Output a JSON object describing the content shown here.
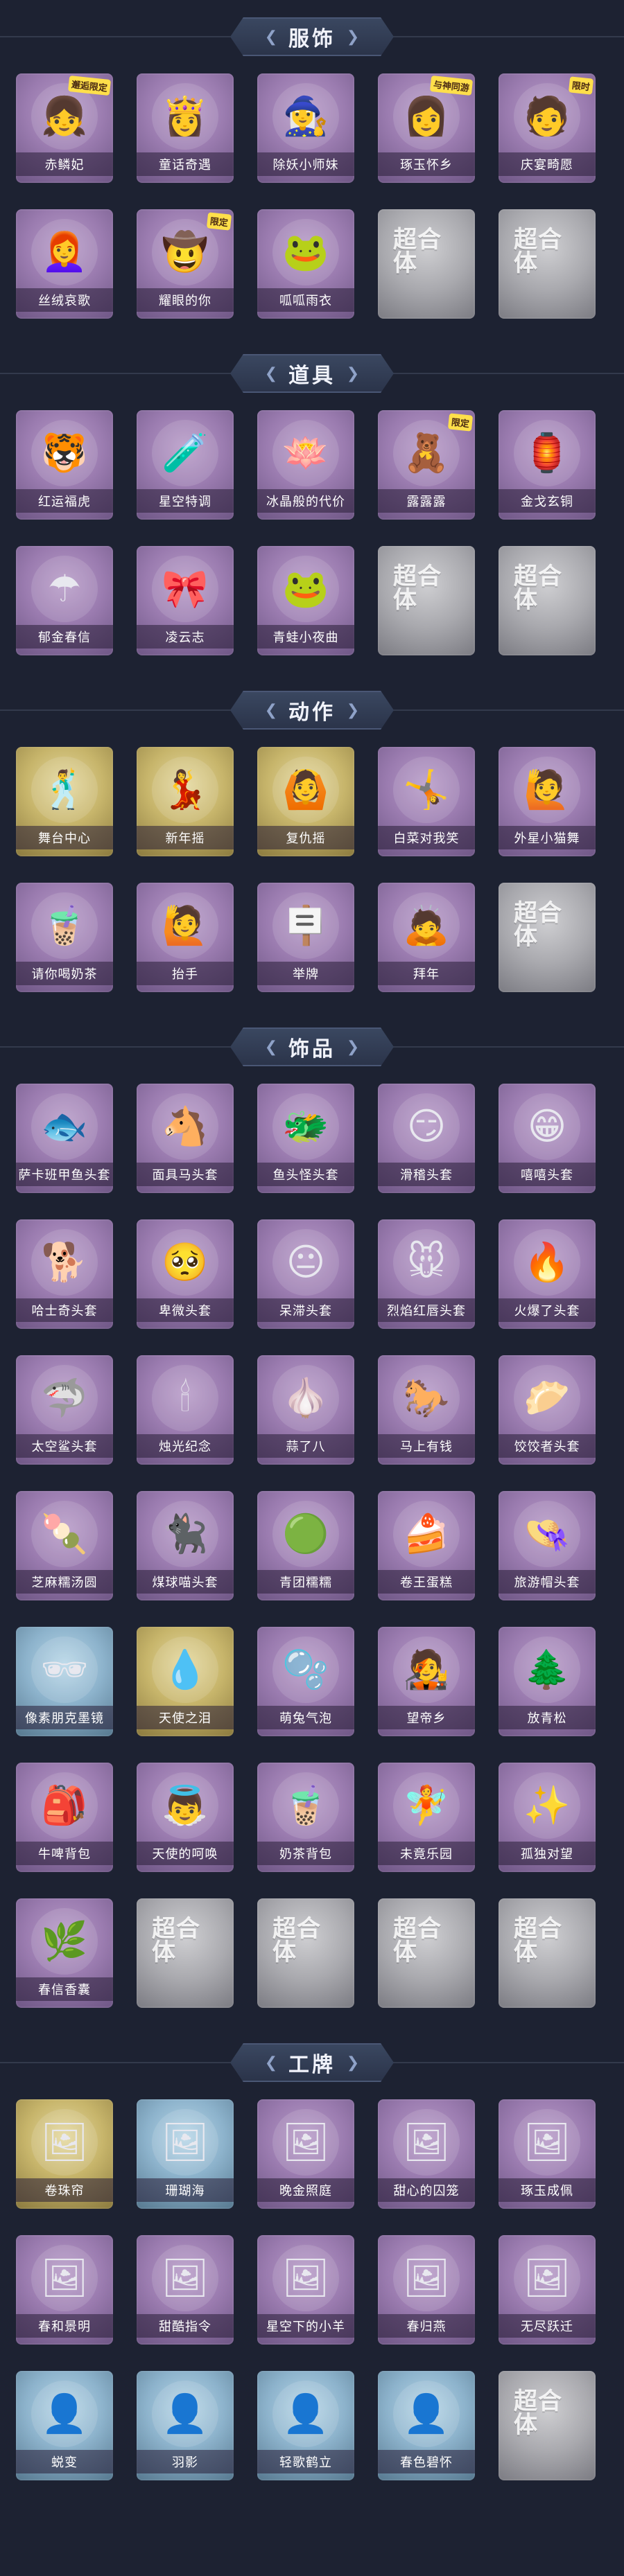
{
  "sections": [
    {
      "title": "服饰",
      "items": [
        {
          "label": "赤鳞妃",
          "style": "purple",
          "icon": "girl-costume-icon",
          "glyph": "👧",
          "badge": "邂逅限定"
        },
        {
          "label": "童话奇遇",
          "style": "purple",
          "icon": "girl-costume-icon",
          "glyph": "👸"
        },
        {
          "label": "除妖小师妹",
          "style": "purple",
          "icon": "girl-costume-icon",
          "glyph": "🧙‍♀️"
        },
        {
          "label": "琢玉怀乡",
          "style": "purple",
          "icon": "girl-costume-icon",
          "glyph": "👩",
          "badge": "与神同游"
        },
        {
          "label": "庆宴畸愿",
          "style": "purple",
          "icon": "girl-costume-icon",
          "glyph": "🧑",
          "badge": "限时"
        },
        {
          "label": "丝绒哀歌",
          "style": "purple",
          "icon": "girl-costume-icon",
          "glyph": "👩‍🦰"
        },
        {
          "label": "耀眼的你",
          "style": "purple",
          "icon": "girl-costume-icon",
          "glyph": "🤠",
          "badge": "限定"
        },
        {
          "label": "呱呱雨衣",
          "style": "purple",
          "icon": "frog-raincoat-icon",
          "glyph": "🐸"
        },
        {
          "label": "",
          "style": "gray",
          "icon": "placeholder-logo-icon",
          "placeholder": "超合体"
        },
        {
          "label": "",
          "style": "gray",
          "icon": "placeholder-logo-icon",
          "placeholder": "超合体"
        }
      ]
    },
    {
      "title": "道具",
      "items": [
        {
          "label": "红运福虎",
          "style": "purple",
          "icon": "tiger-icon",
          "glyph": "🐯"
        },
        {
          "label": "星空特调",
          "style": "purple",
          "icon": "bottle-icon",
          "glyph": "🧪"
        },
        {
          "label": "冰晶般的代价",
          "style": "purple",
          "icon": "lotus-icon",
          "glyph": "🪷"
        },
        {
          "label": "露露露",
          "style": "purple",
          "icon": "doll-icon",
          "glyph": "🧸",
          "badge": "限定"
        },
        {
          "label": "金戈玄铜",
          "style": "purple",
          "icon": "lantern-icon",
          "glyph": "🏮"
        },
        {
          "label": "郁金春信",
          "style": "purple",
          "icon": "umbrella-icon",
          "glyph": "☂"
        },
        {
          "label": "凌云志",
          "style": "purple",
          "icon": "ribbon-icon",
          "glyph": "🎀"
        },
        {
          "label": "青蛙小夜曲",
          "style": "purple",
          "icon": "frog-icon",
          "glyph": "🐸"
        },
        {
          "label": "",
          "style": "gray",
          "icon": "placeholder-logo-icon",
          "placeholder": "超合体"
        },
        {
          "label": "",
          "style": "gray",
          "icon": "placeholder-logo-icon",
          "placeholder": "超合体"
        }
      ]
    },
    {
      "title": "动作",
      "items": [
        {
          "label": "舞台中心",
          "style": "gold",
          "icon": "dance-pose-icon",
          "glyph": "🕺"
        },
        {
          "label": "新年摇",
          "style": "gold",
          "icon": "dance-pose-icon",
          "glyph": "💃"
        },
        {
          "label": "复仇摇",
          "style": "gold",
          "icon": "dance-pose-icon",
          "glyph": "🙆"
        },
        {
          "label": "白菜对我笑",
          "style": "purple",
          "icon": "dance-pose-icon",
          "glyph": "🤸"
        },
        {
          "label": "外星小猫舞",
          "style": "purple",
          "icon": "dance-pose-icon",
          "glyph": "🙋"
        },
        {
          "label": "请你喝奶茶",
          "style": "purple",
          "icon": "milk-tea-pose-icon",
          "glyph": "🧋"
        },
        {
          "label": "抬手",
          "style": "purple",
          "icon": "raise-hand-pose-icon",
          "glyph": "🙋"
        },
        {
          "label": "举牌",
          "style": "purple",
          "icon": "sign-pose-icon",
          "glyph": "🪧"
        },
        {
          "label": "拜年",
          "style": "purple",
          "icon": "bow-pose-icon",
          "glyph": "🙇"
        },
        {
          "label": "",
          "style": "gray",
          "icon": "placeholder-logo-icon",
          "placeholder": "超合体"
        }
      ]
    },
    {
      "title": "饰品",
      "items": [
        {
          "label": "萨卡班甲鱼头套",
          "style": "purple",
          "icon": "fish-head-icon",
          "glyph": "🐟"
        },
        {
          "label": "面具马头套",
          "style": "purple",
          "icon": "horse-head-icon",
          "glyph": "🐴"
        },
        {
          "label": "鱼头怪头套",
          "style": "purple",
          "icon": "fish-monster-icon",
          "glyph": "🐲"
        },
        {
          "label": "滑稽头套",
          "style": "purple",
          "icon": "smile-face-icon",
          "glyph": "😏"
        },
        {
          "label": "嘻嘻头套",
          "style": "purple",
          "icon": "grin-face-icon",
          "glyph": "😁"
        },
        {
          "label": "哈士奇头套",
          "style": "purple",
          "icon": "husky-icon",
          "glyph": "🐕"
        },
        {
          "label": "卑微头套",
          "style": "purple",
          "icon": "sad-face-icon",
          "glyph": "🥺"
        },
        {
          "label": "呆滞头套",
          "style": "purple",
          "icon": "blank-face-icon",
          "glyph": "😐"
        },
        {
          "label": "烈焰红唇头套",
          "style": "purple",
          "icon": "pikachu-icon",
          "glyph": "🐭"
        },
        {
          "label": "火爆了头套",
          "style": "purple",
          "icon": "fire-icon",
          "glyph": "🔥"
        },
        {
          "label": "太空鲨头套",
          "style": "purple",
          "icon": "shark-icon",
          "glyph": "🦈"
        },
        {
          "label": "烛光纪念",
          "style": "purple",
          "icon": "candle-icon",
          "glyph": "🕯"
        },
        {
          "label": "蒜了八",
          "style": "purple",
          "icon": "garlic-icon",
          "glyph": "🧄"
        },
        {
          "label": "马上有钱",
          "style": "purple",
          "icon": "horse-toy-icon",
          "glyph": "🐎"
        },
        {
          "label": "饺饺者头套",
          "style": "purple",
          "icon": "dumpling-icon",
          "glyph": "🥟"
        },
        {
          "label": "芝麻糯汤圆",
          "style": "purple",
          "icon": "rice-ball-icon",
          "glyph": "🍡"
        },
        {
          "label": "煤球喵头套",
          "style": "purple",
          "icon": "black-cat-icon",
          "glyph": "🐈‍⬛"
        },
        {
          "label": "青团糯糯",
          "style": "purple",
          "icon": "green-ball-icon",
          "glyph": "🟢"
        },
        {
          "label": "卷王蛋糕",
          "style": "purple",
          "icon": "cake-roll-icon",
          "glyph": "🍰"
        },
        {
          "label": "旅游帽头套",
          "style": "purple",
          "icon": "hat-icon",
          "glyph": "👒"
        },
        {
          "label": "像素朋克墨镜",
          "style": "blue",
          "icon": "pixel-sunglasses-icon",
          "glyph": "🕶"
        },
        {
          "label": "天使之泪",
          "style": "gold",
          "icon": "angel-tear-icon",
          "glyph": "💧"
        },
        {
          "label": "萌兔气泡",
          "style": "purple",
          "icon": "bubble-icon",
          "glyph": "🫧"
        },
        {
          "label": "望帝乡",
          "style": "purple",
          "icon": "figure-icon",
          "glyph": "🧑‍🎤"
        },
        {
          "label": "放青松",
          "style": "purple",
          "icon": "bonsai-icon",
          "glyph": "🌲"
        },
        {
          "label": "牛啤背包",
          "style": "purple",
          "icon": "backpack-icon",
          "glyph": "🎒"
        },
        {
          "label": "天使的呵唤",
          "style": "purple",
          "icon": "angel-icon",
          "glyph": "👼"
        },
        {
          "label": "奶茶背包",
          "style": "purple",
          "icon": "tea-bag-icon",
          "glyph": "🧋"
        },
        {
          "label": "未竟乐园",
          "style": "purple",
          "icon": "fairy-icon",
          "glyph": "🧚"
        },
        {
          "label": "孤独对望",
          "style": "purple",
          "icon": "star-charm-icon",
          "glyph": "✨"
        },
        {
          "label": "春信香囊",
          "style": "purple",
          "icon": "sachet-icon",
          "glyph": "🌿"
        },
        {
          "label": "",
          "style": "gray",
          "icon": "placeholder-logo-icon",
          "placeholder": "超合体"
        },
        {
          "label": "",
          "style": "gray",
          "icon": "placeholder-logo-icon",
          "placeholder": "超合体"
        },
        {
          "label": "",
          "style": "gray",
          "icon": "placeholder-logo-icon",
          "placeholder": "超合体"
        },
        {
          "label": "",
          "style": "gray",
          "icon": "placeholder-logo-icon",
          "placeholder": "超合体"
        }
      ]
    },
    {
      "title": "工牌",
      "items": [
        {
          "label": "卷珠帘",
          "style": "gold",
          "icon": "card-frame-icon",
          "glyph": "🖼"
        },
        {
          "label": "珊瑚海",
          "style": "blue",
          "icon": "card-frame-icon",
          "glyph": "🖼"
        },
        {
          "label": "晚金照庭",
          "style": "purple",
          "icon": "card-frame-icon",
          "glyph": "🖼"
        },
        {
          "label": "甜心的囚笼",
          "style": "purple",
          "icon": "card-frame-icon",
          "glyph": "🖼"
        },
        {
          "label": "琢玉成佩",
          "style": "purple",
          "icon": "card-frame-icon",
          "glyph": "🖼"
        },
        {
          "label": "春和景明",
          "style": "purple",
          "icon": "card-frame-icon",
          "glyph": "🖼"
        },
        {
          "label": "甜酷指令",
          "style": "purple",
          "icon": "card-frame-icon",
          "glyph": "🖼"
        },
        {
          "label": "星空下的小羊",
          "style": "purple",
          "icon": "card-frame-icon",
          "glyph": "🖼"
        },
        {
          "label": "春归燕",
          "style": "purple",
          "icon": "card-frame-icon",
          "glyph": "🖼"
        },
        {
          "label": "无尽跃迁",
          "style": "purple",
          "icon": "card-frame-icon",
          "glyph": "🖼"
        },
        {
          "label": "蜕变",
          "style": "blue",
          "icon": "silhouette-card-icon",
          "glyph": "👤"
        },
        {
          "label": "羽影",
          "style": "blue",
          "icon": "silhouette-card-icon",
          "glyph": "👤"
        },
        {
          "label": "轻歌鹤立",
          "style": "blue",
          "icon": "silhouette-card-icon",
          "glyph": "👤"
        },
        {
          "label": "春色碧怀",
          "style": "blue",
          "icon": "silhouette-card-icon",
          "glyph": "👤"
        },
        {
          "label": "",
          "style": "gray",
          "icon": "placeholder-logo-icon",
          "placeholder": "超合体"
        }
      ]
    }
  ]
}
